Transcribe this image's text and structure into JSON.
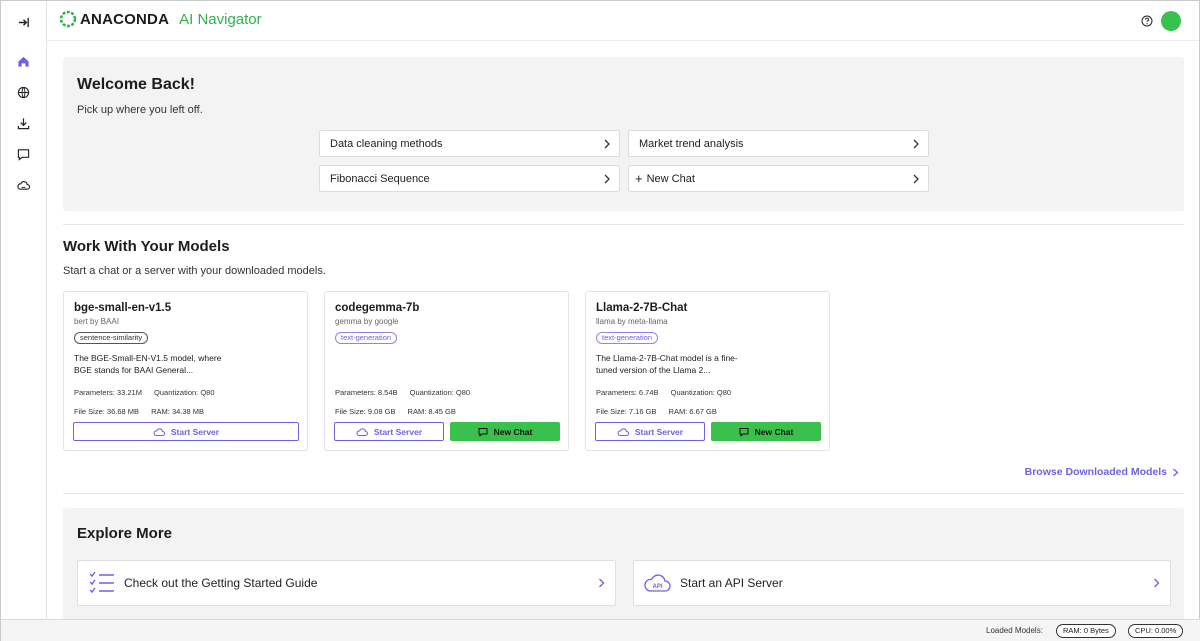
{
  "app": {
    "brand": "ANACONDA",
    "product": "AI Navigator",
    "brand_color": "#2fb34a",
    "accent_color": "#6f62e0"
  },
  "sidebar": {
    "items": [
      {
        "icon": "collapse-icon"
      },
      {
        "icon": "home-icon"
      },
      {
        "icon": "globe-icon"
      },
      {
        "icon": "download-icon"
      },
      {
        "icon": "chat-icon"
      },
      {
        "icon": "cloud-icon"
      }
    ]
  },
  "welcome": {
    "title": "Welcome Back!",
    "subtitle": "Pick up where you left off.",
    "recent": [
      {
        "label": "Data cleaning methods"
      },
      {
        "label": "Market trend analysis"
      },
      {
        "label": "Fibonacci Sequence"
      },
      {
        "label": "New Chat",
        "prefix": "+"
      }
    ]
  },
  "models_section": {
    "title": "Work With Your Models",
    "subtitle": "Start a chat or a server with your downloaded models.",
    "models": [
      {
        "name": "bge-small-en-v1.5",
        "by": "bert by BAAI",
        "tag": "sentence-similarity",
        "description": "The BGE-Small-EN-V1.5 model, where BGE stands for BAAI General...",
        "parameters": "Parameters: 33.21M",
        "quantization": "Quantization: Q80",
        "file_size": "File Size: 36.68 MB",
        "ram": "RAM: 34.38 MB",
        "server_label": "Start Server"
      },
      {
        "name": "codegemma-7b",
        "by": "gemma by google",
        "tag": "text-generation",
        "description": "",
        "parameters": "Parameters: 8.54B",
        "quantization": "Quantization: Q80",
        "file_size": "File Size: 9.08 GB",
        "ram": "RAM: 8.45 GB",
        "server_label": "Start Server",
        "chat_label": "New Chat"
      },
      {
        "name": "Llama-2-7B-Chat",
        "by": "llama by meta-llama",
        "tag": "text-generation",
        "description": "The Llama-2-7B-Chat model is a fine-tuned version of the Llama 2...",
        "parameters": "Parameters: 6.74B",
        "quantization": "Quantization: Q80",
        "file_size": "File Size: 7.16 GB",
        "ram": "RAM: 6.67 GB",
        "server_label": "Start Server",
        "chat_label": "New Chat"
      }
    ],
    "browse_link": "Browse Downloaded Models"
  },
  "explore": {
    "title": "Explore More",
    "cards": [
      {
        "label": "Check out the Getting Started Guide",
        "icon": "checklist-icon"
      },
      {
        "label": "Start an API Server",
        "icon": "api-cloud-icon"
      }
    ]
  },
  "statusbar": {
    "loaded_label": "Loaded Models:",
    "ram": "RAM: 0 Bytes",
    "cpu": "CPU: 0.00%"
  }
}
